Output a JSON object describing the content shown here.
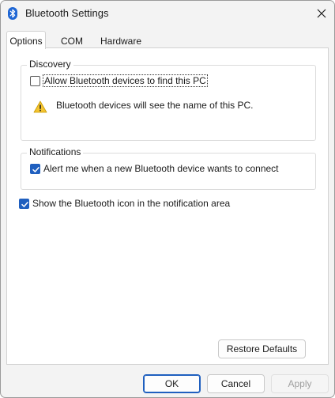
{
  "window": {
    "title": "Bluetooth Settings",
    "app_icon": "bluetooth-icon",
    "close_icon": "close-icon"
  },
  "tabs": [
    {
      "label": "Options",
      "active": true
    },
    {
      "label": "COM Ports",
      "active": false
    },
    {
      "label": "Hardware",
      "active": false
    }
  ],
  "discovery": {
    "legend": "Discovery",
    "allow_label": "Allow Bluetooth devices to find this PC",
    "allow_checked": false,
    "warning_text": "Bluetooth devices will see the name of this PC.",
    "warning_icon": "warning-icon"
  },
  "notifications": {
    "legend": "Notifications",
    "alert_label": "Alert me when a new Bluetooth device wants to connect",
    "alert_checked": true
  },
  "show_icon": {
    "label": "Show the Bluetooth icon in the notification area",
    "checked": true
  },
  "buttons": {
    "restore_defaults": "Restore Defaults",
    "ok": "OK",
    "cancel": "Cancel",
    "apply": "Apply"
  },
  "colors": {
    "accent": "#1f5fbf",
    "warning": "#f4c430"
  }
}
